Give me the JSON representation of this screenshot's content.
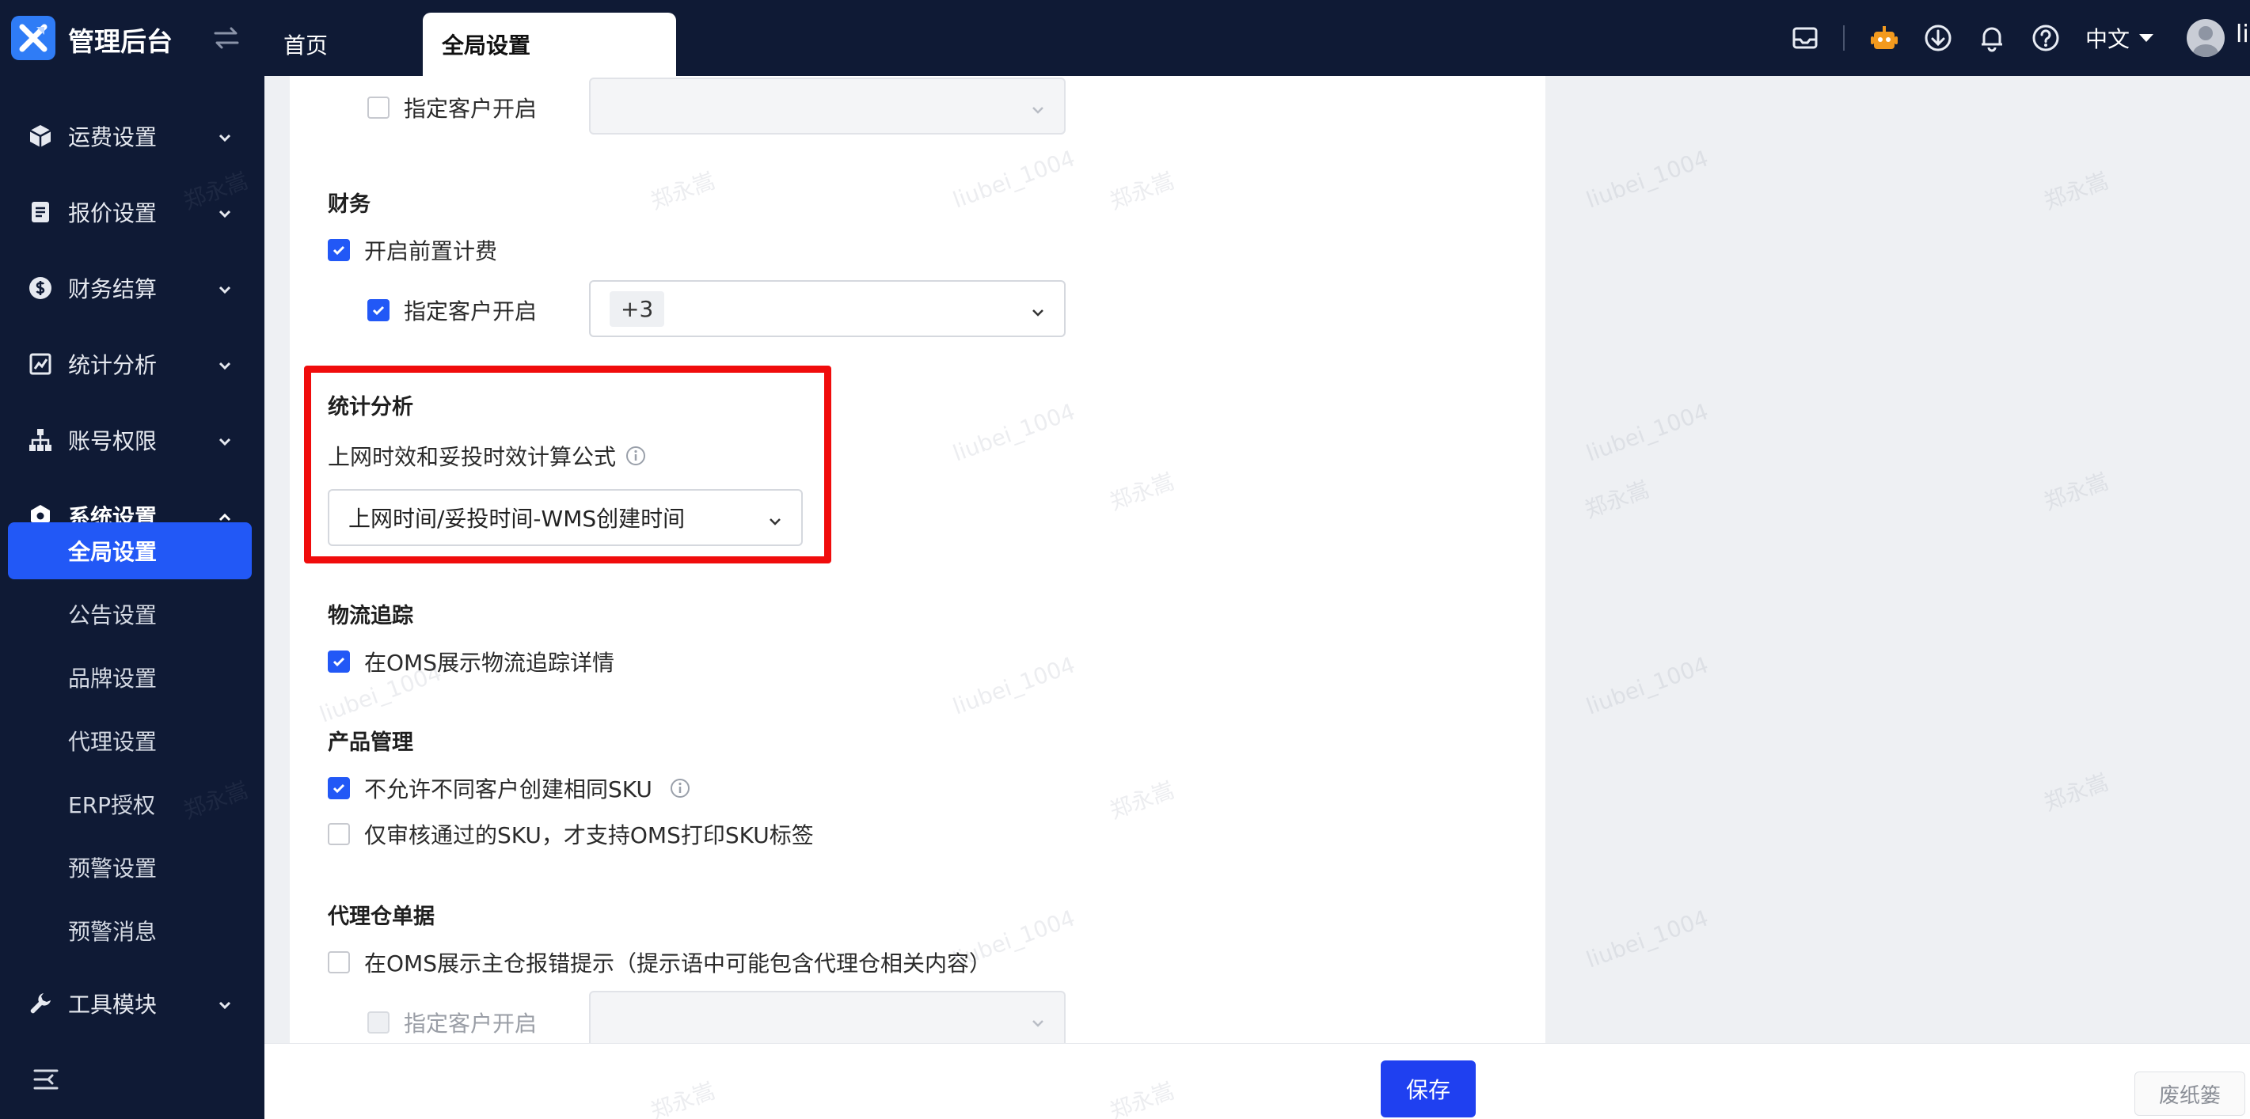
{
  "header": {
    "app_title": "管理后台",
    "tabs": [
      {
        "label": "首页"
      },
      {
        "label": "全局设置"
      }
    ],
    "language": "中文",
    "user_initial": "li"
  },
  "sidebar": {
    "groups": [
      {
        "label": "运费设置",
        "icon": "cube-icon"
      },
      {
        "label": "报价设置",
        "icon": "document-icon"
      },
      {
        "label": "财务结算",
        "icon": "dollar-icon"
      },
      {
        "label": "统计分析",
        "icon": "chart-icon"
      },
      {
        "label": "账号权限",
        "icon": "org-icon"
      },
      {
        "label": "系统设置",
        "icon": "hexagon-icon"
      },
      {
        "label": "工具模块",
        "icon": "wrench-icon"
      }
    ],
    "sub_items": [
      {
        "label": "全局设置"
      },
      {
        "label": "公告设置"
      },
      {
        "label": "品牌设置"
      },
      {
        "label": "代理设置"
      },
      {
        "label": "ERP授权"
      },
      {
        "label": "预警设置"
      },
      {
        "label": "预警消息"
      }
    ]
  },
  "content": {
    "top_row": {
      "label": "指定客户开启",
      "checked": false
    },
    "finance": {
      "title": "财务",
      "prepay_label": "开启前置计费",
      "specify_label": "指定客户开启",
      "tag": "+3"
    },
    "stats": {
      "title": "统计分析",
      "formula_label": "上网时效和妥投时效计算公式",
      "formula_value": "上网时间/妥投时间-WMS创建时间"
    },
    "logistics": {
      "title": "物流追踪",
      "show_label": "在OMS展示物流追踪详情"
    },
    "product": {
      "title": "产品管理",
      "sku_unique_label": "不允许不同客户创建相同SKU",
      "sku_print_label": "仅审核通过的SKU，才支持OMS打印SKU标签"
    },
    "proxy": {
      "title": "代理仓单据",
      "error_label": "在OMS展示主仓报错提示（提示语中可能包含代理仓相关内容）",
      "specify_label": "指定客户开启"
    }
  },
  "footer": {
    "save_label": "保存",
    "trash_label": "废纸篓"
  },
  "watermark": {
    "name": "郑永嵩",
    "id": "liubei_1004"
  },
  "colors": {
    "primary": "#2258f6",
    "sidebar_bg": "#0f1a35",
    "highlight": "#f00c0c"
  }
}
